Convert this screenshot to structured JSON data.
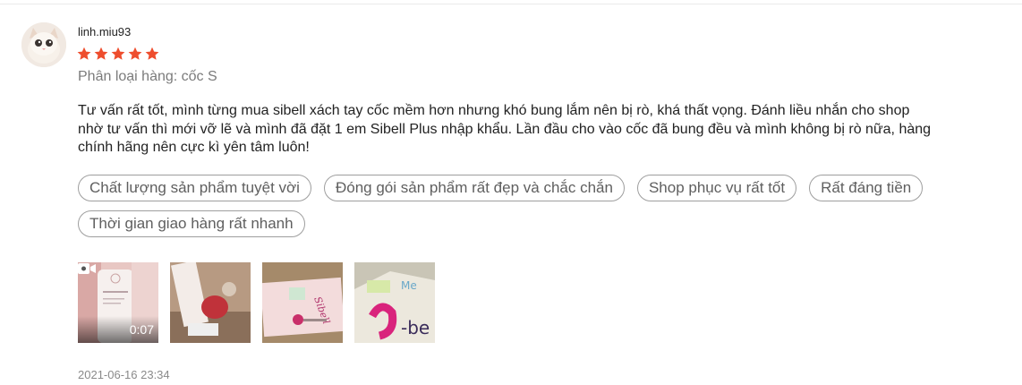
{
  "review": {
    "username": "linh.miu93",
    "rating": 5,
    "variant_text": "Phân loại hàng: cốc S",
    "content_line1": "Tư vấn rất tốt, mình từng mua sibell xách tay cốc mềm hơn nhưng khó bung lắm nên bị rò, khá thất vọng. Đánh liều nhắn cho shop",
    "content_line2": "nhờ tư vấn thì mới vỡ lẽ và mình đã đặt 1 em Sibell Plus nhập khẩu. Lần đầu cho vào cốc đã bung đều và mình không bị rò nữa, hàng",
    "content_line3": "chính hãng nên cực kì yên tâm luôn!",
    "tags": [
      "Chất lượng sản phẩm tuyệt vời",
      "Đóng gói sản phẩm rất đẹp và chắc chắn",
      "Shop phục vụ rất tốt",
      "Rất đáng tiền",
      "Thời gian giao hàng rất nhanh"
    ],
    "video_duration": "0:07",
    "timestamp": "2021-06-16 23:34"
  },
  "colors": {
    "star": "#ee4d2d",
    "tag_border": "#9e9e9e",
    "muted_text": "#7b7b7b"
  }
}
